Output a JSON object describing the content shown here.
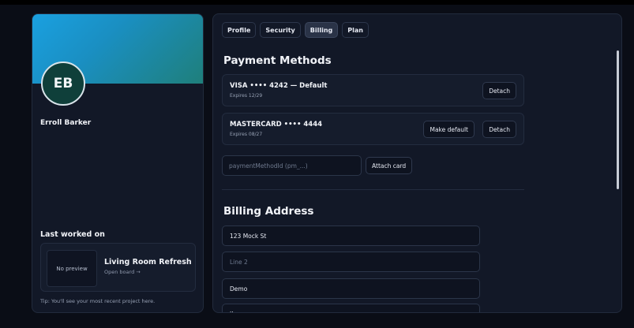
{
  "user": {
    "initials": "EB",
    "name": "Erroll Barker"
  },
  "last_worked": {
    "title": "Last worked on",
    "preview_label": "No preview",
    "project_name": "Living Room Refresh",
    "open_board_label": "Open board →",
    "tip": "Tip: You'll see your most recent project here."
  },
  "tabs": [
    {
      "label": "Profile",
      "active": false
    },
    {
      "label": "Security",
      "active": false
    },
    {
      "label": "Billing",
      "active": true
    },
    {
      "label": "Plan",
      "active": false
    }
  ],
  "payment": {
    "title": "Payment Methods",
    "methods": [
      {
        "name": "VISA •••• 4242 — Default",
        "expires": "Expires 12/29",
        "detach_label": "Detach"
      },
      {
        "name": "MASTERCARD •••• 4444",
        "expires": "Expires 08/27",
        "make_default_label": "Make default",
        "detach_label": "Detach"
      }
    ],
    "input_placeholder": "paymentMethodId (pm_...)",
    "input_value": "",
    "attach_label": "Attach card"
  },
  "billing": {
    "title": "Billing Address",
    "line1": "123 Mock St",
    "line2_placeholder": "Line 2",
    "line2": "",
    "city": "Demo",
    "state": "IL"
  },
  "colors": {
    "background": "#0a0d16",
    "card": "#121827",
    "banner_start": "#1aa0e0",
    "banner_end": "#1f7f7a",
    "avatar": "#0f3f3a"
  }
}
